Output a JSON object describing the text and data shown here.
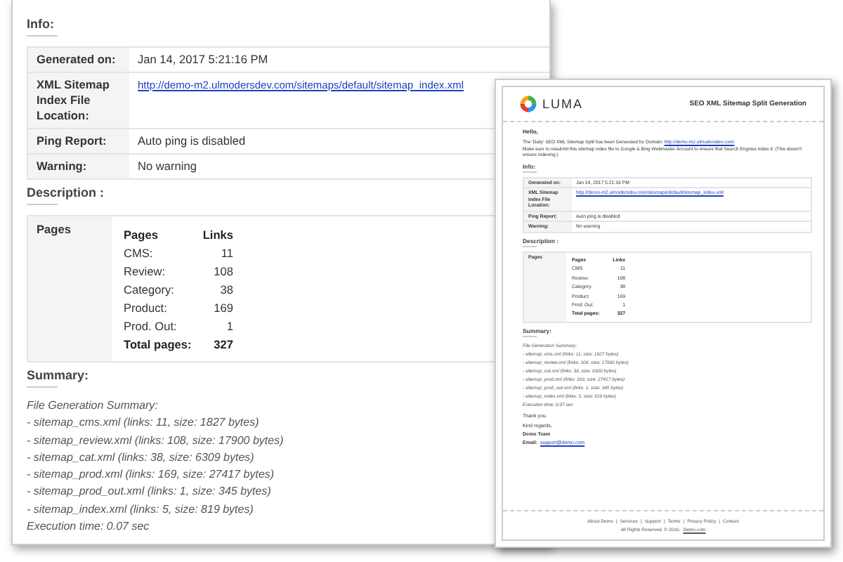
{
  "report": {
    "info_heading": "Info:",
    "info_rows": [
      {
        "label": "Generated on:",
        "value": "Jan 14, 2017 5:21:16 PM",
        "kind": "text"
      },
      {
        "label": "XML Sitemap Index File Location:",
        "value": "http://demo-m2.ulmodersdev.com/sitemaps/default/sitemap_index.xml",
        "kind": "link"
      },
      {
        "label": "Ping Report:",
        "value": "Auto ping is disabled",
        "kind": "text"
      },
      {
        "label": "Warning:",
        "value": "No warning",
        "kind": "text"
      }
    ],
    "description_heading": "Description :",
    "pages_label": "Pages",
    "columns": [
      "Pages",
      "Links"
    ],
    "page_rows": [
      {
        "label": "CMS:",
        "value": "11",
        "kind": "normal"
      },
      {
        "label": "Review:",
        "value": "108",
        "kind": "normal"
      },
      {
        "label": "Category:",
        "value": "38",
        "kind": "normal"
      },
      {
        "label": "Product:",
        "value": "169",
        "kind": "normal"
      },
      {
        "label": "Prod. Out:",
        "value": "1",
        "kind": "normal"
      },
      {
        "label": "Total pages:",
        "value": "327",
        "kind": "total"
      }
    ],
    "summary_heading": "Summary:",
    "summary_lines": [
      "File Generation Summary:",
      "- sitemap_cms.xml (links: 11, size: 1827 bytes)",
      "- sitemap_review.xml (links: 108, size: 17900 bytes)",
      "- sitemap_cat.xml (links: 38, size: 6309 bytes)",
      "- sitemap_prod.xml (links: 169, size: 27417 bytes)",
      "- sitemap_prod_out.xml (links: 1, size: 345 bytes)",
      "- sitemap_index.xml (links: 5, size: 819 bytes)",
      "Execution time: 0.07 sec"
    ]
  },
  "email": {
    "logo_text": "LUMA",
    "subject": "SEO XML Sitemap Split Generation",
    "greeting": "Hello,",
    "intro": "The 'Daily' SEO XML Sitemap Split has been Generated for Domain:",
    "intro_link": "http://demo-m2.ulmodersdev.com/",
    "intro_note": "Make sure to resubmit this sitemap index file to Google & Bing Webmaster Account to ensure that Search Engines index it. (This doesn't ensure indexing.)",
    "report": {
      "info_heading": "Info:",
      "info_rows": [
        {
          "label": "Generated on:",
          "value": "Jan 14, 2017 5:21:16 PM",
          "kind": "text"
        },
        {
          "label": "XML Sitemap Index File Location:",
          "value": "http://demo-m2.ulmodersdev.com/sitemaps/default/sitemap_index.xml",
          "kind": "link"
        },
        {
          "label": "Ping Report:",
          "value": "Auto ping is disabled",
          "kind": "text"
        },
        {
          "label": "Warning:",
          "value": "No warning",
          "kind": "text"
        }
      ],
      "description_heading": "Description :",
      "pages_label": "Pages",
      "columns": [
        "Pages",
        "Links"
      ],
      "page_rows": [
        {
          "label": "CMS:",
          "value": "11",
          "kind": "normal"
        },
        {
          "label": "Review:",
          "value": "108",
          "kind": "normal"
        },
        {
          "label": "Category:",
          "value": "38",
          "kind": "normal"
        },
        {
          "label": "Product:",
          "value": "169",
          "kind": "normal"
        },
        {
          "label": "Prod. Out:",
          "value": "1",
          "kind": "normal"
        },
        {
          "label": "Total pages:",
          "value": "327",
          "kind": "total"
        }
      ],
      "summary_heading": "Summary:",
      "summary_lines": [
        "File Generation Summary:",
        "- sitemap_cms.xml (links: 11, size: 1827 bytes)",
        "- sitemap_review.xml (links: 108, size: 17900 bytes)",
        "- sitemap_cat.xml (links: 38, size: 6309 bytes)",
        "- sitemap_prod.xml (links: 169, size: 27417 bytes)",
        "- sitemap_prod_out.xml (links: 1, size: 345 bytes)",
        "- sitemap_index.xml (links: 5, size: 819 bytes)",
        "Execution time: 0.07 sec"
      ]
    },
    "thanks": "Thank you.",
    "regards": "Kind regards,",
    "team": "Demo Team",
    "email_label": "Email:",
    "email_link": "support@demo.com",
    "footer_links": [
      "About Demo",
      "Services",
      "Support",
      "Terms",
      "Privacy Policy",
      "Contact"
    ],
    "footer_separator": "|",
    "copyright": "All Rights Reserved. © 2016.",
    "copyright_link": "Demo.com"
  }
}
